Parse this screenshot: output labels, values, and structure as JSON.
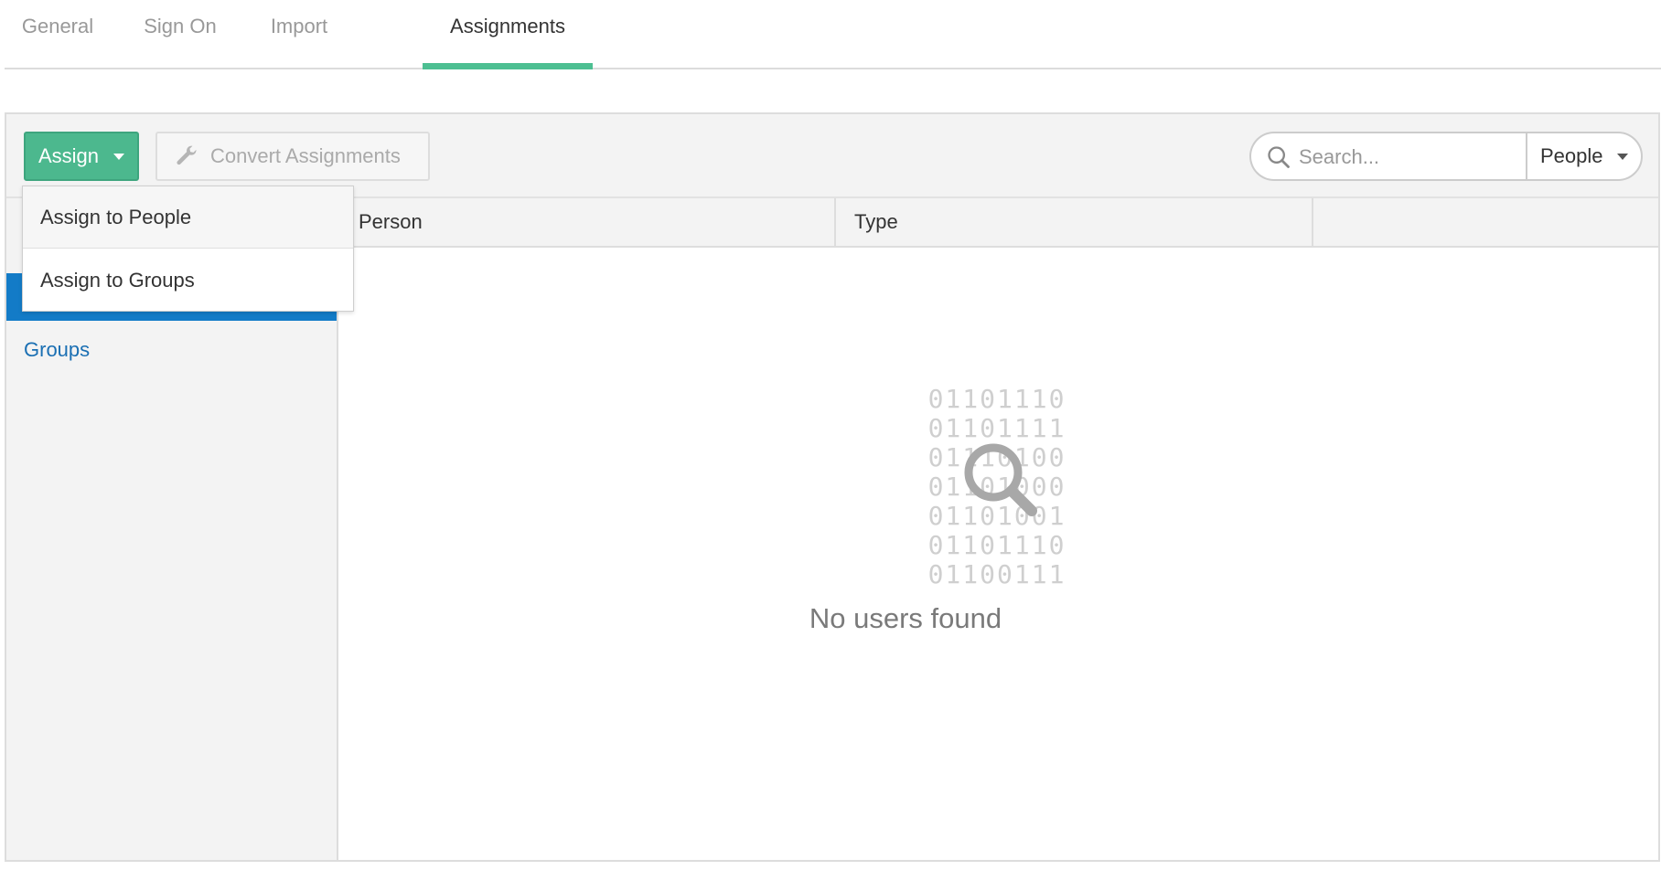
{
  "tabs": [
    {
      "label": "General",
      "active": false
    },
    {
      "label": "Sign On",
      "active": false
    },
    {
      "label": "Import",
      "active": false
    },
    {
      "label": "Assignments",
      "active": true
    }
  ],
  "toolbar": {
    "assign_label": "Assign",
    "convert_label": "Convert Assignments",
    "search_placeholder": "Search...",
    "filter_value": "People"
  },
  "assign_menu": [
    "Assign to People",
    "Assign to Groups"
  ],
  "sidebar": {
    "items": [
      {
        "label": "",
        "active": true
      },
      {
        "label": "Groups",
        "active": false
      }
    ]
  },
  "table": {
    "columns": [
      "Person",
      "Type"
    ]
  },
  "empty_state": {
    "binary": [
      "01101110",
      "01101111",
      "01110100",
      "01101000",
      "01101001",
      "01101110",
      "01100111"
    ],
    "message": "No users found"
  },
  "colors": {
    "accent": "#4dbf92",
    "assign_button": "#4cb88e",
    "active_sidebar": "#137bc7",
    "link": "#1a6fb3"
  },
  "icons": {
    "convert": "wrench-icon",
    "search": "search-icon",
    "empty": "magnifier-icon"
  }
}
